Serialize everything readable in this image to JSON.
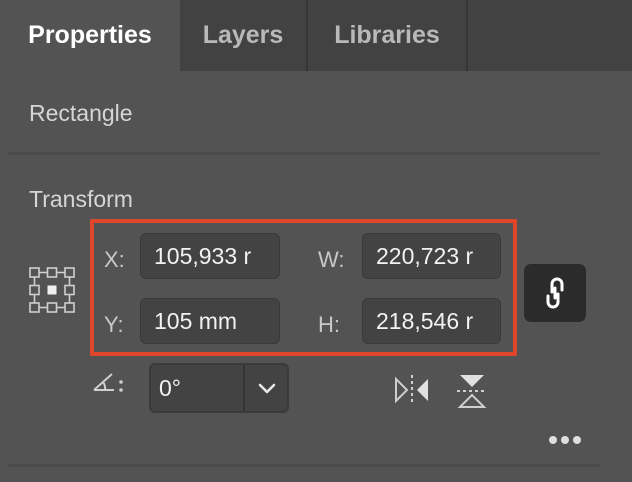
{
  "tabs": [
    {
      "label": "Properties",
      "active": true
    },
    {
      "label": "Layers",
      "active": false
    },
    {
      "label": "Libraries",
      "active": false
    }
  ],
  "object_type": "Rectangle",
  "transform": {
    "title": "Transform",
    "x_label": "X:",
    "x_value": "105,933 r",
    "y_label": "Y:",
    "y_value": "105 mm",
    "w_label": "W:",
    "w_value": "220,723 r",
    "h_label": "H:",
    "h_value": "218,546 r",
    "rotate_label": "0°",
    "highlight_color": "#e0462c"
  },
  "icons": {
    "reference_point": "reference-point-grid-icon",
    "constrain": "link-icon",
    "rotate": "rotate-angle-icon",
    "dropdown": "chevron-down-icon",
    "flip_horizontal": "flip-horizontal-icon",
    "flip_vertical": "flip-vertical-icon",
    "more": "more-options-icon"
  }
}
